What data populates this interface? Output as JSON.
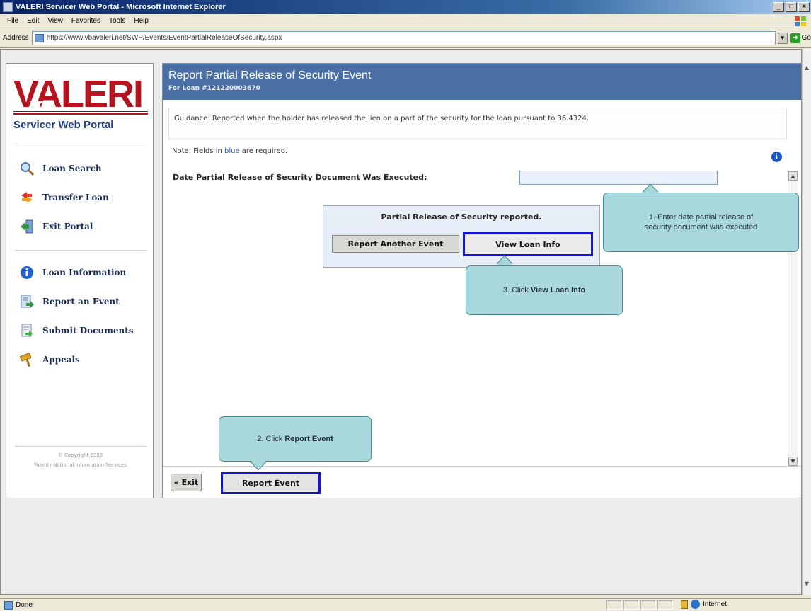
{
  "window": {
    "title": "VALERI Servicer Web Portal - Microsoft Internet Explorer",
    "buttons": [
      "_",
      "□",
      "×"
    ]
  },
  "menubar": [
    "File",
    "Edit",
    "View",
    "Favorites",
    "Tools",
    "Help"
  ],
  "address": {
    "label": "Address",
    "url": "https://www.vbavaleri.net/SWP/Events/EventPartialReleaseOfSecurity.aspx",
    "go_label": "Go"
  },
  "sidebar": {
    "logo_text": "VALERI",
    "logo_subtitle": "Servicer Web Portal",
    "nav_primary": [
      {
        "label": "Loan Search",
        "icon": "magnifier-icon"
      },
      {
        "label": "Transfer Loan",
        "icon": "transfer-arrows-icon"
      },
      {
        "label": "Exit Portal",
        "icon": "exit-door-icon"
      }
    ],
    "nav_secondary": [
      {
        "label": "Loan Information",
        "icon": "info-icon"
      },
      {
        "label": "Report an Event",
        "icon": "report-document-icon"
      },
      {
        "label": "Submit Documents",
        "icon": "submit-document-icon"
      },
      {
        "label": "Appeals",
        "icon": "gavel-icon"
      }
    ],
    "copyright_line1": "© Copyright 2008",
    "copyright_line2": "Fidelity National Information Services"
  },
  "main": {
    "title": "Report Partial Release of Security Event",
    "subtitle": "For Loan #121220003670",
    "guidance": "Guidance: Reported when the holder has released the lien on a part of the security for the loan pursuant to 36.4324.",
    "note_prefix": "Note: Fields in ",
    "note_blue": "blue",
    "note_suffix": " are required.",
    "field_label": "Date Partial Release of Security Document Was Executed:",
    "field_value": "",
    "popup": {
      "message": "Partial Release of Security reported.",
      "report_another_label": "Report Another Event",
      "view_loan_label": "View Loan Info"
    },
    "footer": {
      "exit_label": "« Exit",
      "report_event_label": "Report Event"
    }
  },
  "callouts": {
    "step1_line1": "1.   Enter date partial release of",
    "step1_line2": "security document was executed",
    "step2_prefix": "2.   Click ",
    "step2_bold": "Report Event",
    "step3_prefix": "3.   Click ",
    "step3_bold": "View Loan Info"
  },
  "statusbar": {
    "status": "Done",
    "zone": "Internet"
  },
  "colors": {
    "header_blue": "#4a6fa5",
    "brand_red": "#b4161f",
    "brand_navy": "#1e3a7a",
    "highlight_outline": "#1515d6",
    "callout_fill": "#a8d8dc"
  }
}
